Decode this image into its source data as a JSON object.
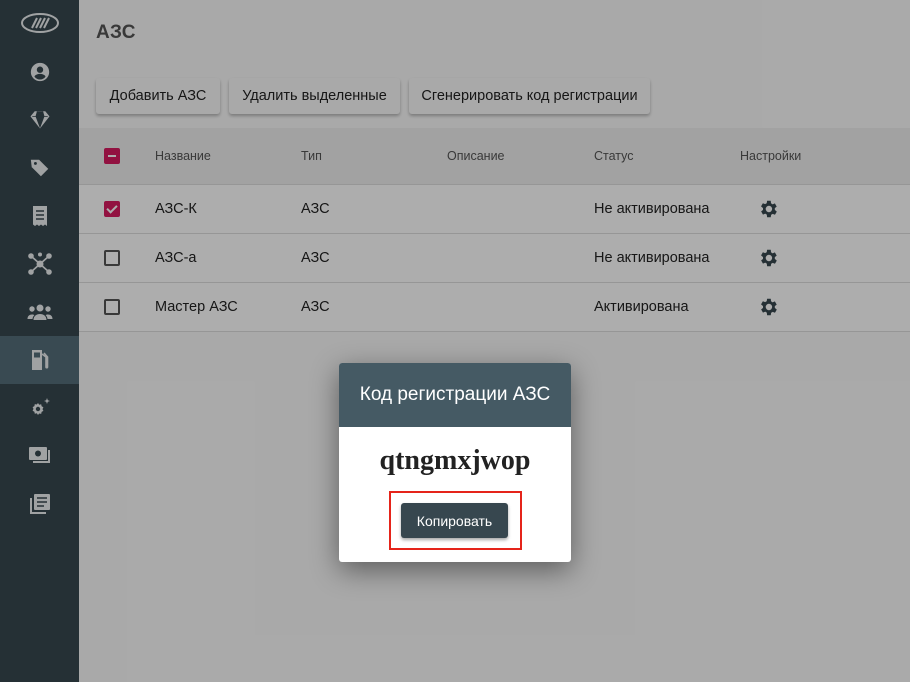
{
  "page": {
    "title": "АЗС"
  },
  "sidebar": {
    "items": [
      {
        "icon": "logo-icon"
      },
      {
        "icon": "account-icon"
      },
      {
        "icon": "diamond-icon"
      },
      {
        "icon": "tags-icon"
      },
      {
        "icon": "receipt-icon"
      },
      {
        "icon": "network-icon"
      },
      {
        "icon": "users-group-icon"
      },
      {
        "icon": "gas-station-icon",
        "active": true
      },
      {
        "icon": "settings-sparkle-icon"
      },
      {
        "icon": "money-icon"
      },
      {
        "icon": "library-icon"
      }
    ]
  },
  "toolbar": {
    "add_label": "Добавить АЗС",
    "delete_label": "Удалить выделенные",
    "generate_label": "Сгенерировать код регистрации"
  },
  "table": {
    "headers": {
      "name": "Название",
      "type": "Тип",
      "description": "Описание",
      "status": "Статус",
      "settings": "Настройки"
    },
    "rows": [
      {
        "checked": true,
        "name": "АЗС-К",
        "type": "АЗС",
        "description": "",
        "status": "Не активирована"
      },
      {
        "checked": false,
        "name": "АЗС-а",
        "type": "АЗС",
        "description": "",
        "status": "Не активирована"
      },
      {
        "checked": false,
        "name": "Мастер АЗС",
        "type": "АЗС",
        "description": "",
        "status": "Активирована"
      }
    ]
  },
  "dialog": {
    "title": "Код регистрации АЗС",
    "code": "qtngmxjwop",
    "copy_label": "Копировать"
  },
  "colors": {
    "sidebar": "#37474f",
    "sidebar_active": "#546e7a",
    "dialog_header": "#455a64",
    "checkbox_accent": "#d81b60",
    "highlight": "#e5241a"
  }
}
